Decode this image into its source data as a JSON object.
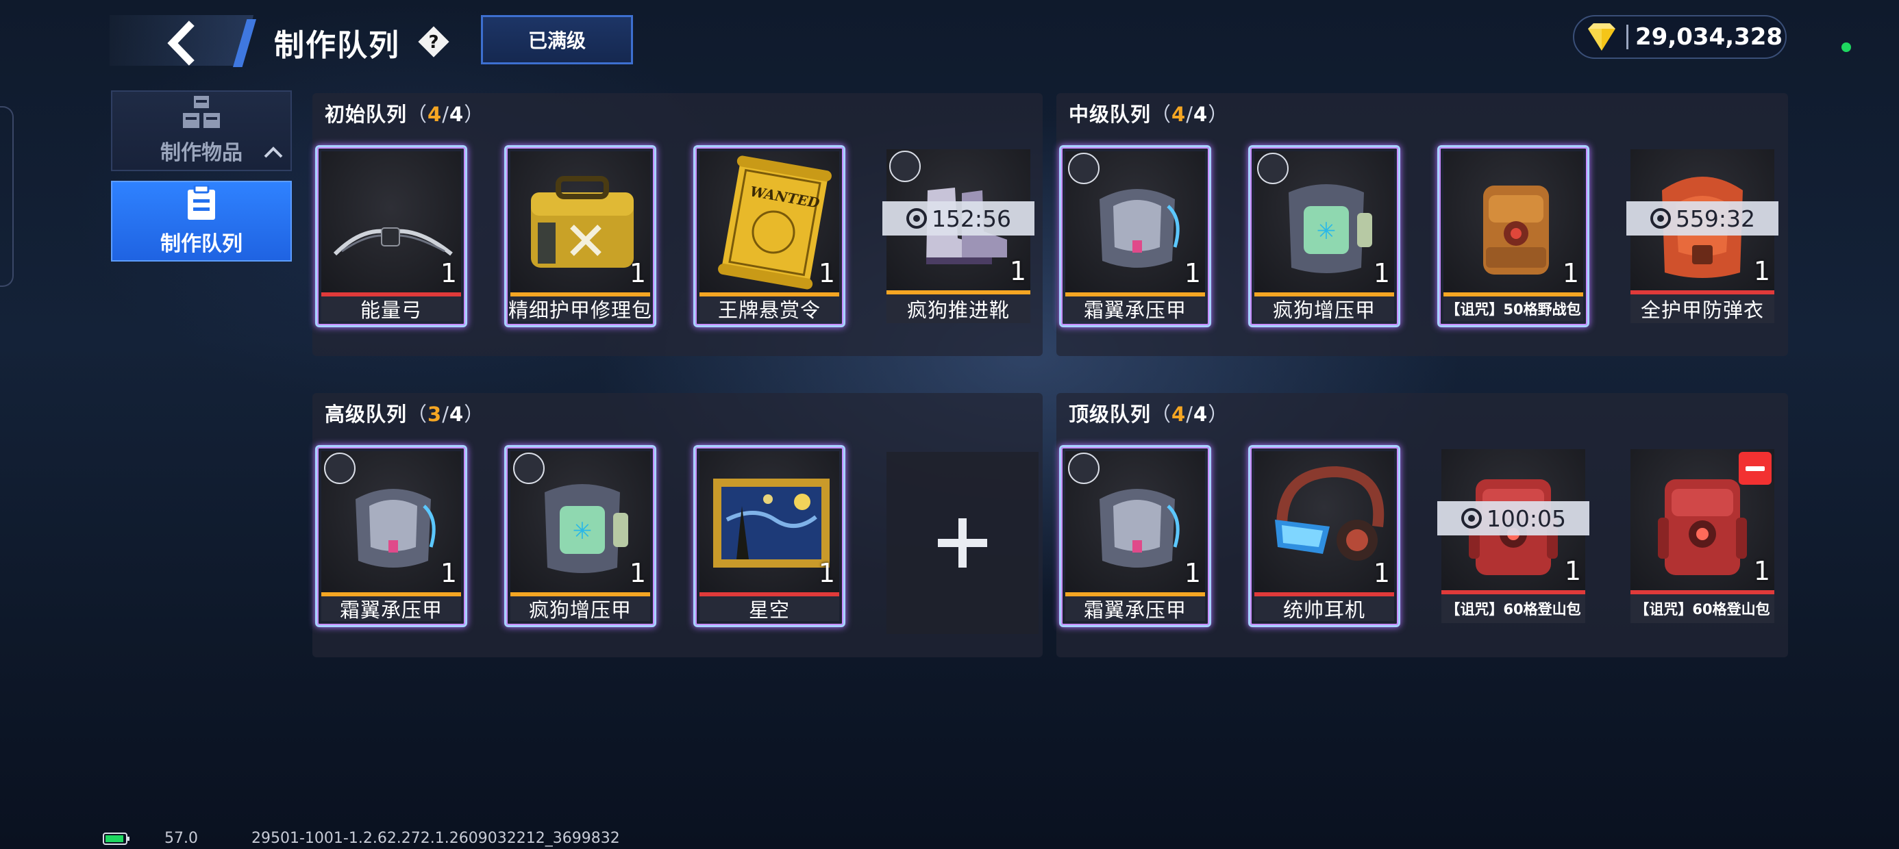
{
  "header": {
    "title": "制作队列",
    "maxed_label": "已满级"
  },
  "currency": {
    "amount": "29,034,328",
    "icon": "gold-gem-icon",
    "color": "#f5c518"
  },
  "sidebar": {
    "items": [
      {
        "label": "制作物品",
        "icon": "crafting-boxes-icon",
        "active": false
      },
      {
        "label": "制作队列",
        "icon": "clipboard-icon",
        "active": true
      }
    ]
  },
  "panels": {
    "initial": {
      "title": "初始队列",
      "current": "4",
      "max": "4",
      "slots": [
        {
          "name": "能量弓",
          "count": "1",
          "timer": "",
          "faction": false,
          "rarity_color": "#e03a3a",
          "icon": "energy-bow-icon"
        },
        {
          "name": "精细护甲修理包",
          "count": "1",
          "timer": "",
          "faction": false,
          "rarity_color": "#f5a623",
          "icon": "repair-kit-bag-icon"
        },
        {
          "name": "王牌悬赏令",
          "count": "1",
          "timer": "",
          "faction": false,
          "rarity_color": "#f5a623",
          "icon": "wanted-scroll-icon",
          "image_text": "WANTED"
        },
        {
          "name": "疯狗推进靴",
          "count": "1",
          "timer": "152:56",
          "faction": true,
          "rarity_color": "#f5a623",
          "icon": "boots-icon"
        }
      ]
    },
    "intermediate": {
      "title": "中级队列",
      "current": "4",
      "max": "4",
      "slots": [
        {
          "name": "霜翼承压甲",
          "count": "1",
          "timer": "",
          "faction": true,
          "rarity_color": "#f5a623",
          "icon": "body-armor-icon"
        },
        {
          "name": "疯狗增压甲",
          "count": "1",
          "timer": "",
          "faction": true,
          "rarity_color": "#f5a623",
          "icon": "pressure-armor-icon"
        },
        {
          "name": "【诅咒】50格野战包",
          "count": "1",
          "timer": "",
          "faction": false,
          "rarity_color": "#f5a623",
          "icon": "backpack-icon"
        },
        {
          "name": "全护甲防弹衣",
          "count": "1",
          "timer": "559:32",
          "faction": false,
          "rarity_color": "#e03a3a",
          "icon": "bulletproof-vest-icon"
        }
      ]
    },
    "advanced": {
      "title": "高级队列",
      "current": "3",
      "max": "4",
      "slots": [
        {
          "name": "霜翼承压甲",
          "count": "1",
          "timer": "",
          "faction": true,
          "rarity_color": "#f5a623",
          "icon": "body-armor-icon"
        },
        {
          "name": "疯狗增压甲",
          "count": "1",
          "timer": "",
          "faction": true,
          "rarity_color": "#f5a623",
          "icon": "pressure-armor-icon"
        },
        {
          "name": "星空",
          "count": "1",
          "timer": "",
          "faction": false,
          "rarity_color": "#e03a3a",
          "icon": "starry-night-painting-icon"
        }
      ]
    },
    "top": {
      "title": "顶级队列",
      "current": "4",
      "max": "4",
      "slots": [
        {
          "name": "霜翼承压甲",
          "count": "1",
          "timer": "",
          "faction": true,
          "rarity_color": "#f5a623",
          "icon": "body-armor-icon"
        },
        {
          "name": "统帅耳机",
          "count": "1",
          "timer": "",
          "faction": false,
          "rarity_color": "#e03a3a",
          "icon": "headset-icon"
        },
        {
          "name": "【诅咒】60格登山包",
          "count": "1",
          "timer": "100:05",
          "faction": false,
          "rarity_color": "#e03a3a",
          "icon": "red-backpack-icon"
        },
        {
          "name": "【诅咒】60格登山包",
          "count": "1",
          "timer": "",
          "faction": false,
          "rarity_color": "#e03a3a",
          "icon": "red-backpack-icon",
          "removable": true
        }
      ]
    }
  },
  "footer": {
    "fps": "57.0",
    "build": "29501-1001-1.2.62.272.1.2609032212_3699832"
  }
}
